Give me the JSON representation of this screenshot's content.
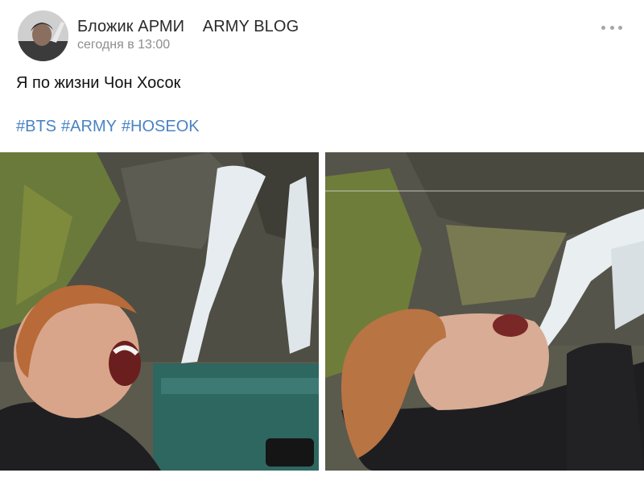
{
  "post": {
    "author": "Бложик АРМИ    ARMY BLOG",
    "time": "сегодня в 13:00",
    "text": "Я по жизни Чон Хосок",
    "tags": [
      "#BTS",
      "#ARMY",
      "#HOSEOK"
    ]
  },
  "icons": {
    "more": "more-horizontal-icon"
  },
  "colors": {
    "link": "#4a83c2",
    "meta": "#8e8e8e",
    "background": "#ffffff"
  }
}
